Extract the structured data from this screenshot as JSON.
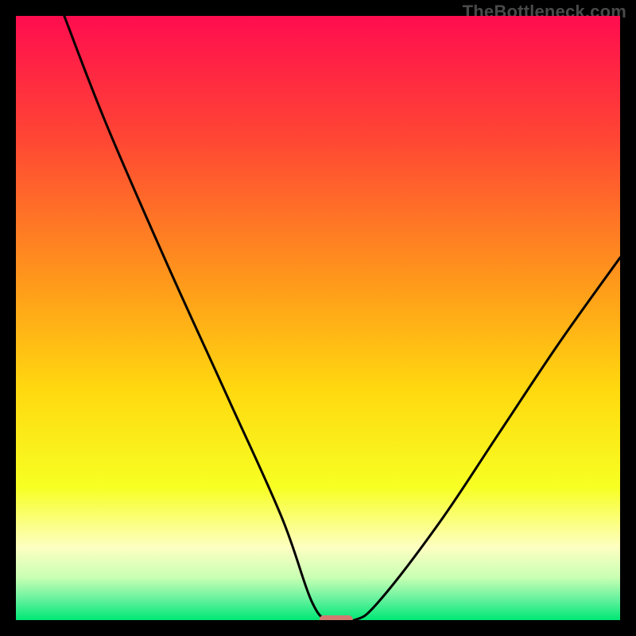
{
  "watermark": "TheBottleneck.com",
  "chart_data": {
    "type": "line",
    "title": "",
    "xlabel": "",
    "ylabel": "",
    "xlim": [
      0,
      100
    ],
    "ylim": [
      0,
      100
    ],
    "background_gradient": {
      "direction": "vertical",
      "stops": [
        {
          "pos": 0.0,
          "color": "#ff0d4f"
        },
        {
          "pos": 0.2,
          "color": "#ff4534"
        },
        {
          "pos": 0.45,
          "color": "#ff9c1a"
        },
        {
          "pos": 0.62,
          "color": "#ffd90f"
        },
        {
          "pos": 0.78,
          "color": "#f7ff23"
        },
        {
          "pos": 0.88,
          "color": "#fdffc2"
        },
        {
          "pos": 0.93,
          "color": "#c8ffb3"
        },
        {
          "pos": 0.965,
          "color": "#66f29e"
        },
        {
          "pos": 1.0,
          "color": "#00e775"
        }
      ]
    },
    "curve": {
      "comment": "Piecewise curve: y≈100 at x≈8, descends, flattens to y≈0 near x=50–56, rises to y≈60 at x=100. Left segment has a slight slope break around x≈25.",
      "x": [
        8,
        15,
        25,
        35,
        44,
        49,
        52,
        56,
        60,
        70,
        80,
        90,
        100
      ],
      "y": [
        100,
        82,
        59,
        37,
        17,
        3,
        0,
        0,
        3,
        16,
        31,
        46,
        60
      ]
    },
    "marker": {
      "comment": "Small rounded strip at the valley floor",
      "x_center": 53,
      "y": 0,
      "width": 5.5,
      "color": "#d17a6f"
    }
  }
}
